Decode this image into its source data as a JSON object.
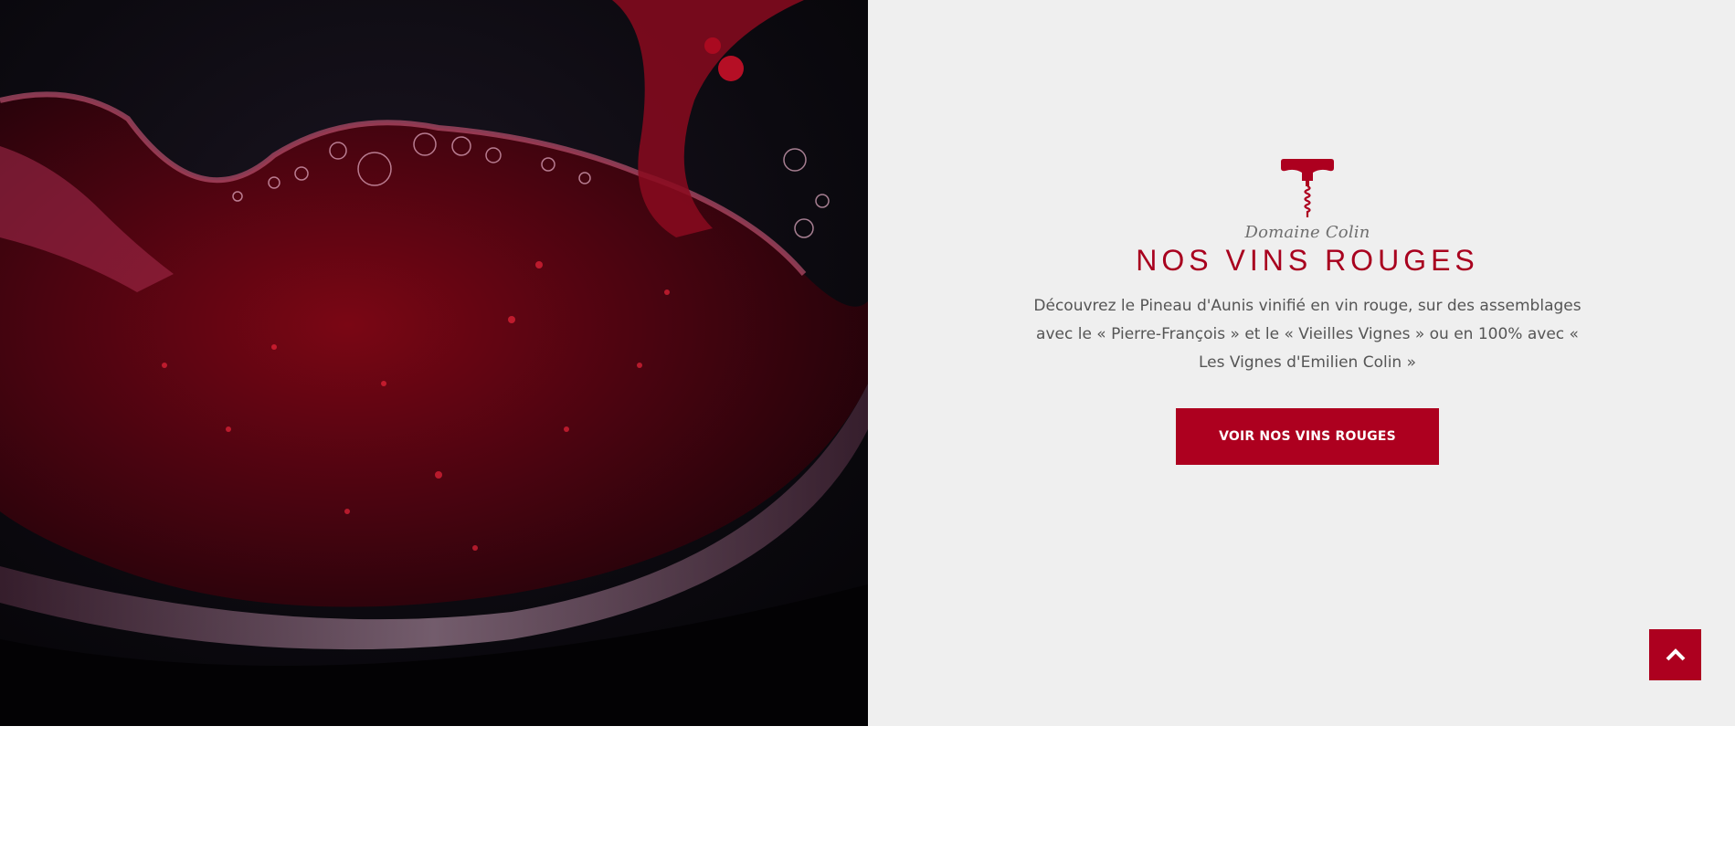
{
  "section": {
    "brand": "Domaine Colin",
    "title": "NOS VINS ROUGES",
    "description": "Découvrez le Pineau d'Aunis vinifié en vin rouge, sur des assemblages avec le « Pierre-François »  et le  « Vieilles Vignes » ou en 100% avec « Les Vignes d'Emilien Colin »",
    "button_label": "VOIR NOS VINS ROUGES",
    "icon": "corkscrew-icon"
  },
  "photo": {
    "subject": "red-wine-glass-image"
  },
  "scroll_top": {
    "icon": "chevron-up-icon"
  },
  "colors": {
    "accent": "#ad001f",
    "title": "#a8001e",
    "panel_bg": "#efefef",
    "text": "#555555"
  }
}
